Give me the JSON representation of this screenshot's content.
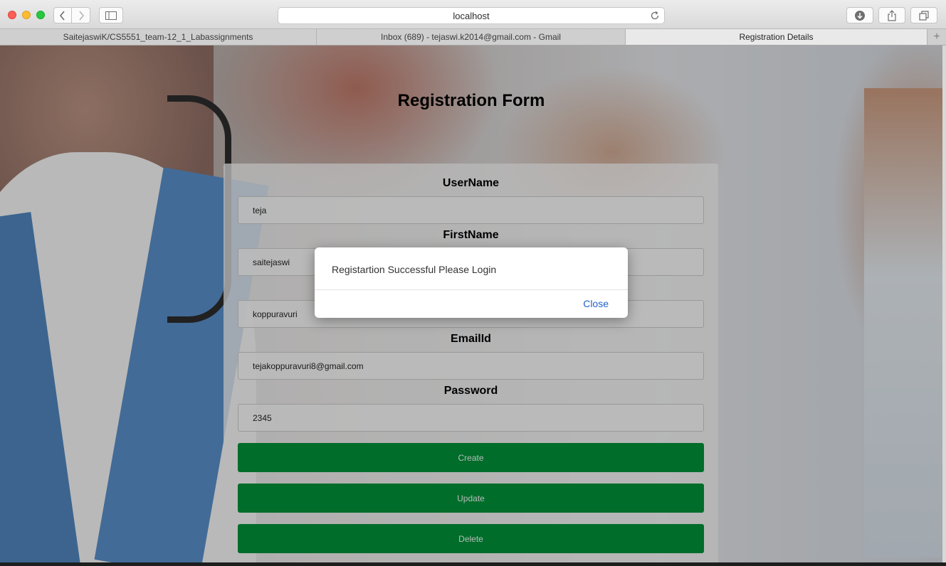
{
  "browser": {
    "url": "localhost",
    "tabs": [
      {
        "label": "SaitejaswiK/CS5551_team-12_1_Labassignments"
      },
      {
        "label": "Inbox (689) - tejaswi.k2014@gmail.com - Gmail"
      },
      {
        "label": "Registration Details",
        "active": true
      }
    ],
    "new_tab_symbol": "+"
  },
  "page": {
    "title": "Registration Form",
    "fields": [
      {
        "label": "UserName",
        "value": "teja"
      },
      {
        "label": "FirstName",
        "value": "saitejaswi"
      },
      {
        "label": "",
        "value": "koppuravuri"
      },
      {
        "label": "EmailId",
        "value": "tejakoppuravuri8@gmail.com"
      },
      {
        "label": "Password",
        "value": "2345"
      }
    ],
    "buttons": {
      "create": "Create",
      "update": "Update",
      "delete": "Delete"
    },
    "button_color": "#008c38"
  },
  "alert": {
    "message": "Registartion Successful Please Login",
    "close_label": "Close",
    "close_color": "#2063d0"
  }
}
